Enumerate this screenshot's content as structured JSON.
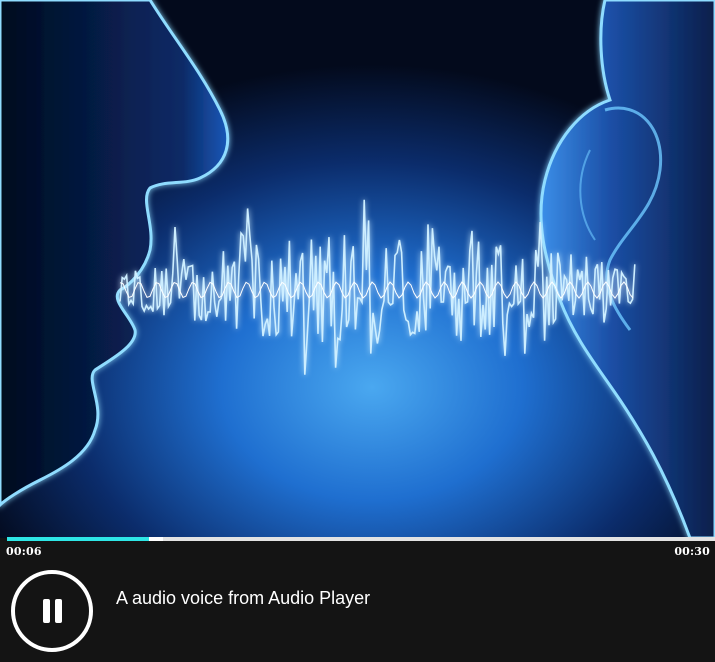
{
  "player": {
    "artwork_icon": "speech-soundwave-artwork",
    "current_time": "00:06",
    "total_time": "00:30",
    "progress": 0.2,
    "track_title": "A audio voice from Audio Player",
    "control_icon": "pause-icon",
    "accent_color": "#2ee6e6"
  }
}
